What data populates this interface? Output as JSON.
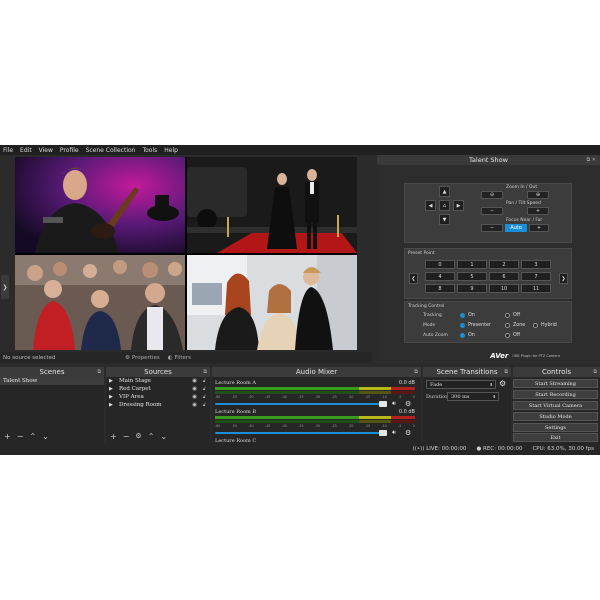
{
  "menu": [
    "File",
    "Edit",
    "View",
    "Profile",
    "Scene Collection",
    "Tools",
    "Help"
  ],
  "preview_status": {
    "no_source": "No source selected",
    "properties": "Properties",
    "filters": "Filters"
  },
  "talent_panel": {
    "title": "Talent Show",
    "zoom_label": "Zoom In / Out",
    "pan_tilt_label": "Pan / Tilt Speed",
    "focus_label": "Focus Near / Far",
    "auto_label": "Auto",
    "preset_label": "Preset Point",
    "presets": [
      "0",
      "1",
      "2",
      "3",
      "4",
      "5",
      "6",
      "7",
      "8",
      "9",
      "10",
      "11"
    ],
    "tracking_control_label": "Tracking Control",
    "tracking_label": "Tracking",
    "mode_label": "Mode",
    "auto_zoom_label": "Auto Zoom",
    "on": "On",
    "off": "Off",
    "presenter": "Presenter",
    "zone": "Zone",
    "hybrid": "Hybrid",
    "brand": "AVer",
    "brand_sub": "OBS Plugin for PTZ Camera"
  },
  "scenes": {
    "title": "Scenes",
    "items": [
      "Talent Show"
    ]
  },
  "sources": {
    "title": "Sources",
    "items": [
      "Main Stage",
      "Red Carpet",
      "VIP Area",
      "Dressing Room"
    ]
  },
  "mixer": {
    "title": "Audio Mixer",
    "tracks": [
      {
        "name": "Lecture Room A",
        "db": "0.0 dB"
      },
      {
        "name": "Lecture Room B",
        "db": "0.0 dB"
      },
      {
        "name": "Lecture Room C",
        "db": ""
      }
    ],
    "scale": [
      "-60",
      "-55",
      "-50",
      "-45",
      "-40",
      "-35",
      "-30",
      "-25",
      "-20",
      "-15",
      "-10",
      "-5",
      "0"
    ]
  },
  "transitions": {
    "title": "Scene Transitions",
    "selected": "Fade",
    "duration_label": "Duration",
    "duration_value": "300 ms"
  },
  "controls": {
    "title": "Controls",
    "buttons": [
      "Start Streaming",
      "Start Recording",
      "Start Virtual Camera",
      "Studio Mode",
      "Settings",
      "Exit"
    ]
  },
  "status": {
    "live": "LIVE: 00:00:00",
    "rec": "REC: 00:00:00",
    "cpu": "CPU: 63.0%, 30.00 fps"
  }
}
